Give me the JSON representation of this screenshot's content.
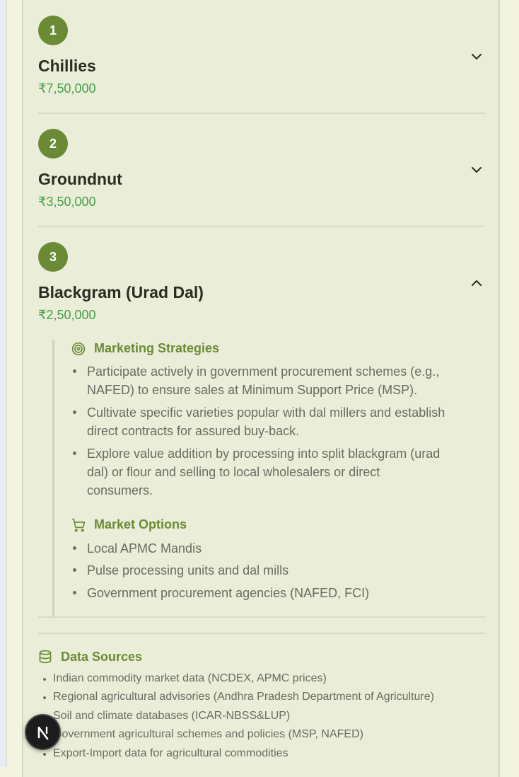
{
  "crops": [
    {
      "rank": "1",
      "name": "Chillies",
      "value": "₹7,50,000",
      "expanded": false
    },
    {
      "rank": "2",
      "name": "Groundnut",
      "value": "₹3,50,000",
      "expanded": false
    },
    {
      "rank": "3",
      "name": "Blackgram (Urad Dal)",
      "value": "₹2,50,000",
      "expanded": true
    }
  ],
  "details": {
    "marketing_title": "Marketing Strategies",
    "marketing_lines": [
      [
        "Participate actively in government procurement schemes (e.g.,",
        "NAFED) to ensure sales at Minimum Support Price (MSP)."
      ],
      [
        "Cultivate specific varieties popular with dal millers and establish",
        "direct contracts for assured buy-back."
      ],
      [
        "Explore value addition by processing into split blackgram (urad",
        "dal) or flour and selling to local wholesalers or direct",
        "consumers."
      ]
    ],
    "market_title": "Market Options",
    "market_items": [
      "Local APMC Mandis",
      "Pulse processing units and dal mills",
      "Government procurement agencies (NAFED, FCI)"
    ]
  },
  "data_sources": {
    "title": "Data Sources",
    "items": [
      "Indian commodity market data (NCDEX, APMC prices)",
      "Regional agricultural advisories (Andhra Pradesh Department of Agriculture)",
      "Soil and climate databases (ICAR-NBSS&LUP)",
      "Government agricultural schemes and policies (MSP, NAFED)",
      "Export-Import data for agricultural commodities"
    ]
  },
  "colors": {
    "accent": "#6b8a35",
    "value_green": "#43a04a",
    "panel_bg": "#eaeed8",
    "page_bg": "#f3f4df"
  },
  "icons": {
    "marketing": "target-icon",
    "market": "cart-icon",
    "data_sources": "database-icon",
    "collapsed": "chevron-down-icon",
    "expanded": "chevron-up-icon",
    "dev_badge": "nextjs-logo-icon"
  }
}
